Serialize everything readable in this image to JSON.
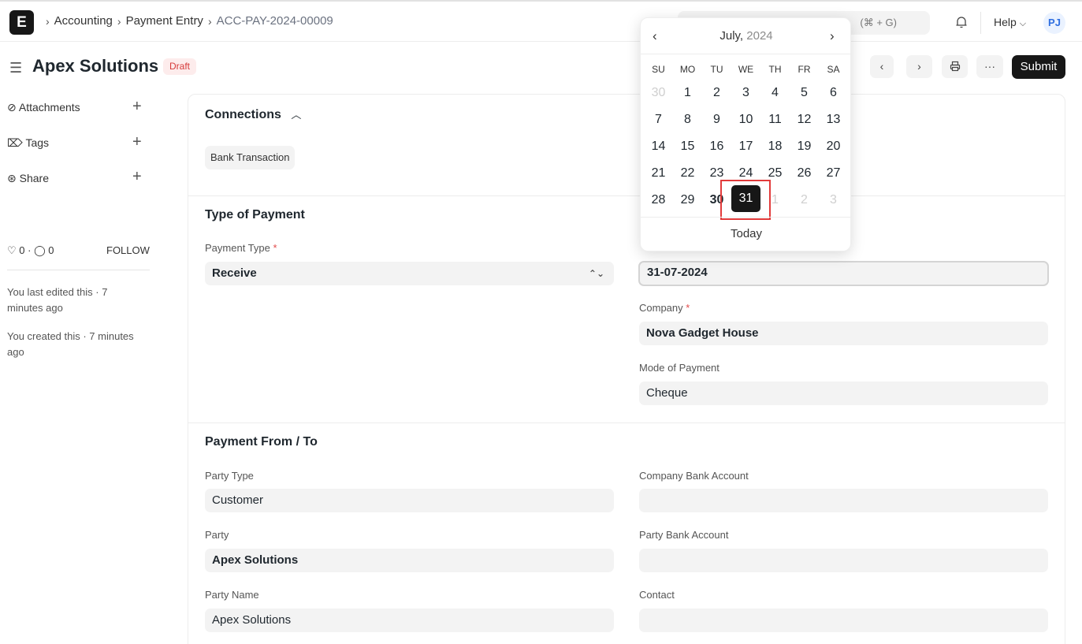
{
  "nav": {
    "logo": "E",
    "crumbs": [
      "Accounting",
      "Payment Entry",
      "ACC-PAY-2024-00009"
    ],
    "search_shortcut": "(⌘ + G)",
    "help": "Help",
    "avatar": "PJ"
  },
  "header": {
    "title": "Apex Solutions",
    "status": "Draft",
    "submit": "Submit",
    "more": "···"
  },
  "sidebar": {
    "attachments": "Attachments",
    "tags": "Tags",
    "share": "Share",
    "likes": "0",
    "comments": "0",
    "follow": "FOLLOW",
    "last_edited": "You last edited this · 7 minutes ago",
    "created": "You created this · 7 minutes ago"
  },
  "connections": {
    "title": "Connections",
    "chip": "Bank Transaction"
  },
  "type_of_payment": {
    "title": "Type of Payment",
    "payment_type_label": "Payment Type",
    "payment_type_value": "Receive",
    "posting_date_value": "31-07-2024",
    "company_label": "Company",
    "company_value": "Nova Gadget House",
    "mode_label": "Mode of Payment",
    "mode_value": "Cheque"
  },
  "payment_from_to": {
    "title": "Payment From / To",
    "party_type_label": "Party Type",
    "party_type_value": "Customer",
    "company_bank_label": "Company Bank Account",
    "party_label": "Party",
    "party_value": "Apex Solutions",
    "party_bank_label": "Party Bank Account",
    "party_name_label": "Party Name",
    "party_name_value": "Apex Solutions",
    "contact_label": "Contact"
  },
  "datepicker": {
    "month": "July,",
    "year": "2024",
    "weekdays": [
      "SU",
      "MO",
      "TU",
      "WE",
      "TH",
      "FR",
      "SA"
    ],
    "weeks": [
      [
        "30",
        "1",
        "2",
        "3",
        "4",
        "5",
        "6"
      ],
      [
        "7",
        "8",
        "9",
        "10",
        "11",
        "12",
        "13"
      ],
      [
        "14",
        "15",
        "16",
        "17",
        "18",
        "19",
        "20"
      ],
      [
        "21",
        "22",
        "23",
        "24",
        "25",
        "26",
        "27"
      ],
      [
        "28",
        "29",
        "30",
        "31",
        "1",
        "2",
        "3"
      ]
    ],
    "selected": "31",
    "today_button": "Today"
  }
}
